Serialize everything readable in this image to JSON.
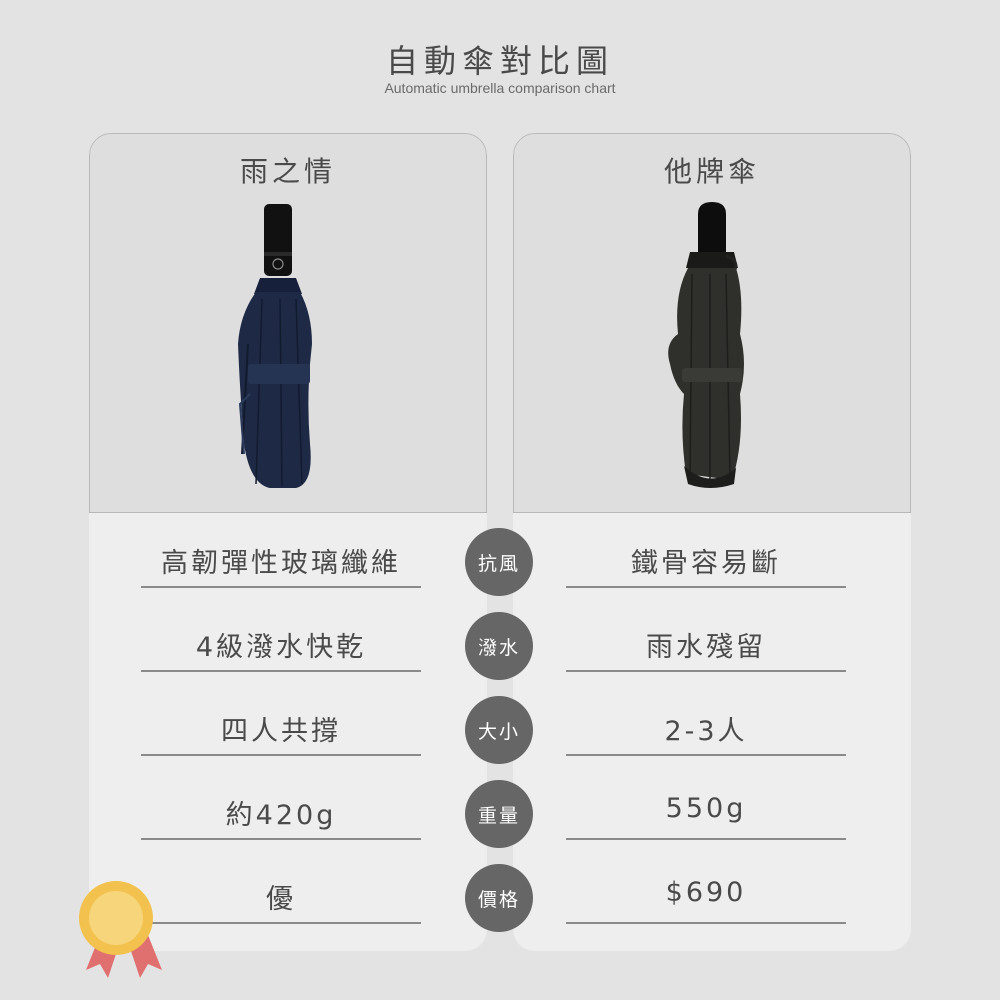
{
  "header": {
    "title": "自動傘對比圖",
    "subtitle": "Automatic umbrella comparison chart"
  },
  "left": {
    "brand": "雨之情",
    "umbrella_color": "#1e2a45",
    "rows": [
      "高韌彈性玻璃纖維",
      "4級潑水快乾",
      "四人共撐",
      "約420g",
      "優"
    ]
  },
  "right": {
    "brand": "他牌傘",
    "umbrella_color": "#2f302c",
    "rows": [
      "鐵骨容易斷",
      "雨水殘留",
      "2-3人",
      "550g",
      "$690"
    ]
  },
  "categories": [
    "抗風",
    "潑水",
    "大小",
    "重量",
    "價格"
  ],
  "colors": {
    "background": "#e3e3e3",
    "card": "#eeeeee",
    "badge": "#666666",
    "medal_gold": "#f2c14e",
    "medal_ribbon": "#e07070"
  },
  "icons": {
    "medal": "gold-medal-icon"
  }
}
